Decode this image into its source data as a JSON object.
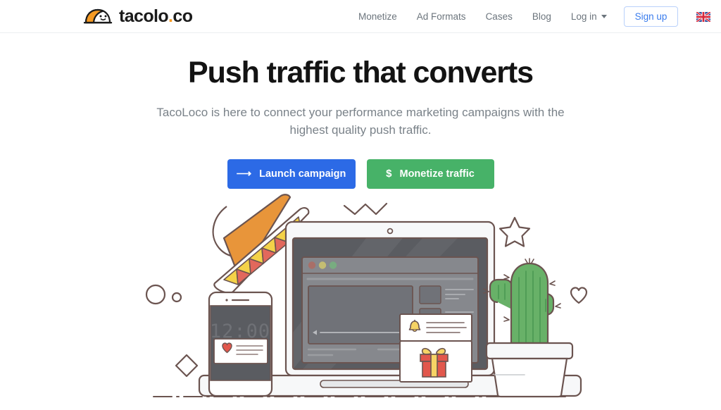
{
  "brand": {
    "logo_text": "tacolo",
    "logo_dot": ".",
    "logo_tld": "co",
    "logo_icon": "taco-icon",
    "accent_orange": "#f59a23"
  },
  "header": {
    "nav": [
      {
        "label": "Monetize",
        "name": "nav-item-monetize"
      },
      {
        "label": "Ad Formats",
        "name": "nav-item-ad-formats"
      },
      {
        "label": "Cases",
        "name": "nav-item-cases"
      },
      {
        "label": "Blog",
        "name": "nav-item-blog"
      }
    ],
    "login_label": "Log in",
    "signup_label": "Sign up",
    "language_flag": "uk-flag-icon",
    "signup_color": "#3b7ded"
  },
  "hero": {
    "headline": "Push traffic that converts",
    "subtitle": "TacoLoco is here to connect your performance marketing campaigns with the highest quality push traffic.",
    "cta_primary": {
      "label": "Launch campaign",
      "icon": "arrow-right-icon",
      "color": "#2c6ae6"
    },
    "cta_secondary": {
      "label": "Monetize traffic",
      "icon": "dollar-icon",
      "color": "#47b268"
    }
  },
  "illustration": {
    "name": "hero-illustration",
    "phone_time": "12:00",
    "elements": [
      "sombrero",
      "laptop",
      "browser-window",
      "video-player",
      "smartphone",
      "notification-card",
      "gift-card",
      "cactus",
      "star",
      "heart",
      "circle-large",
      "circle-small",
      "diamond",
      "zigzag"
    ],
    "colors": {
      "outline": "#6b5450",
      "screen_dark": "#5a5c61",
      "cactus_green": "#68b168",
      "gift_red": "#e2574c",
      "ribbon_yellow": "#f6d365",
      "sombrero_orange": "#e8953a",
      "sombrero_yellow": "#f4d248",
      "sombrero_red": "#e2685c"
    }
  }
}
